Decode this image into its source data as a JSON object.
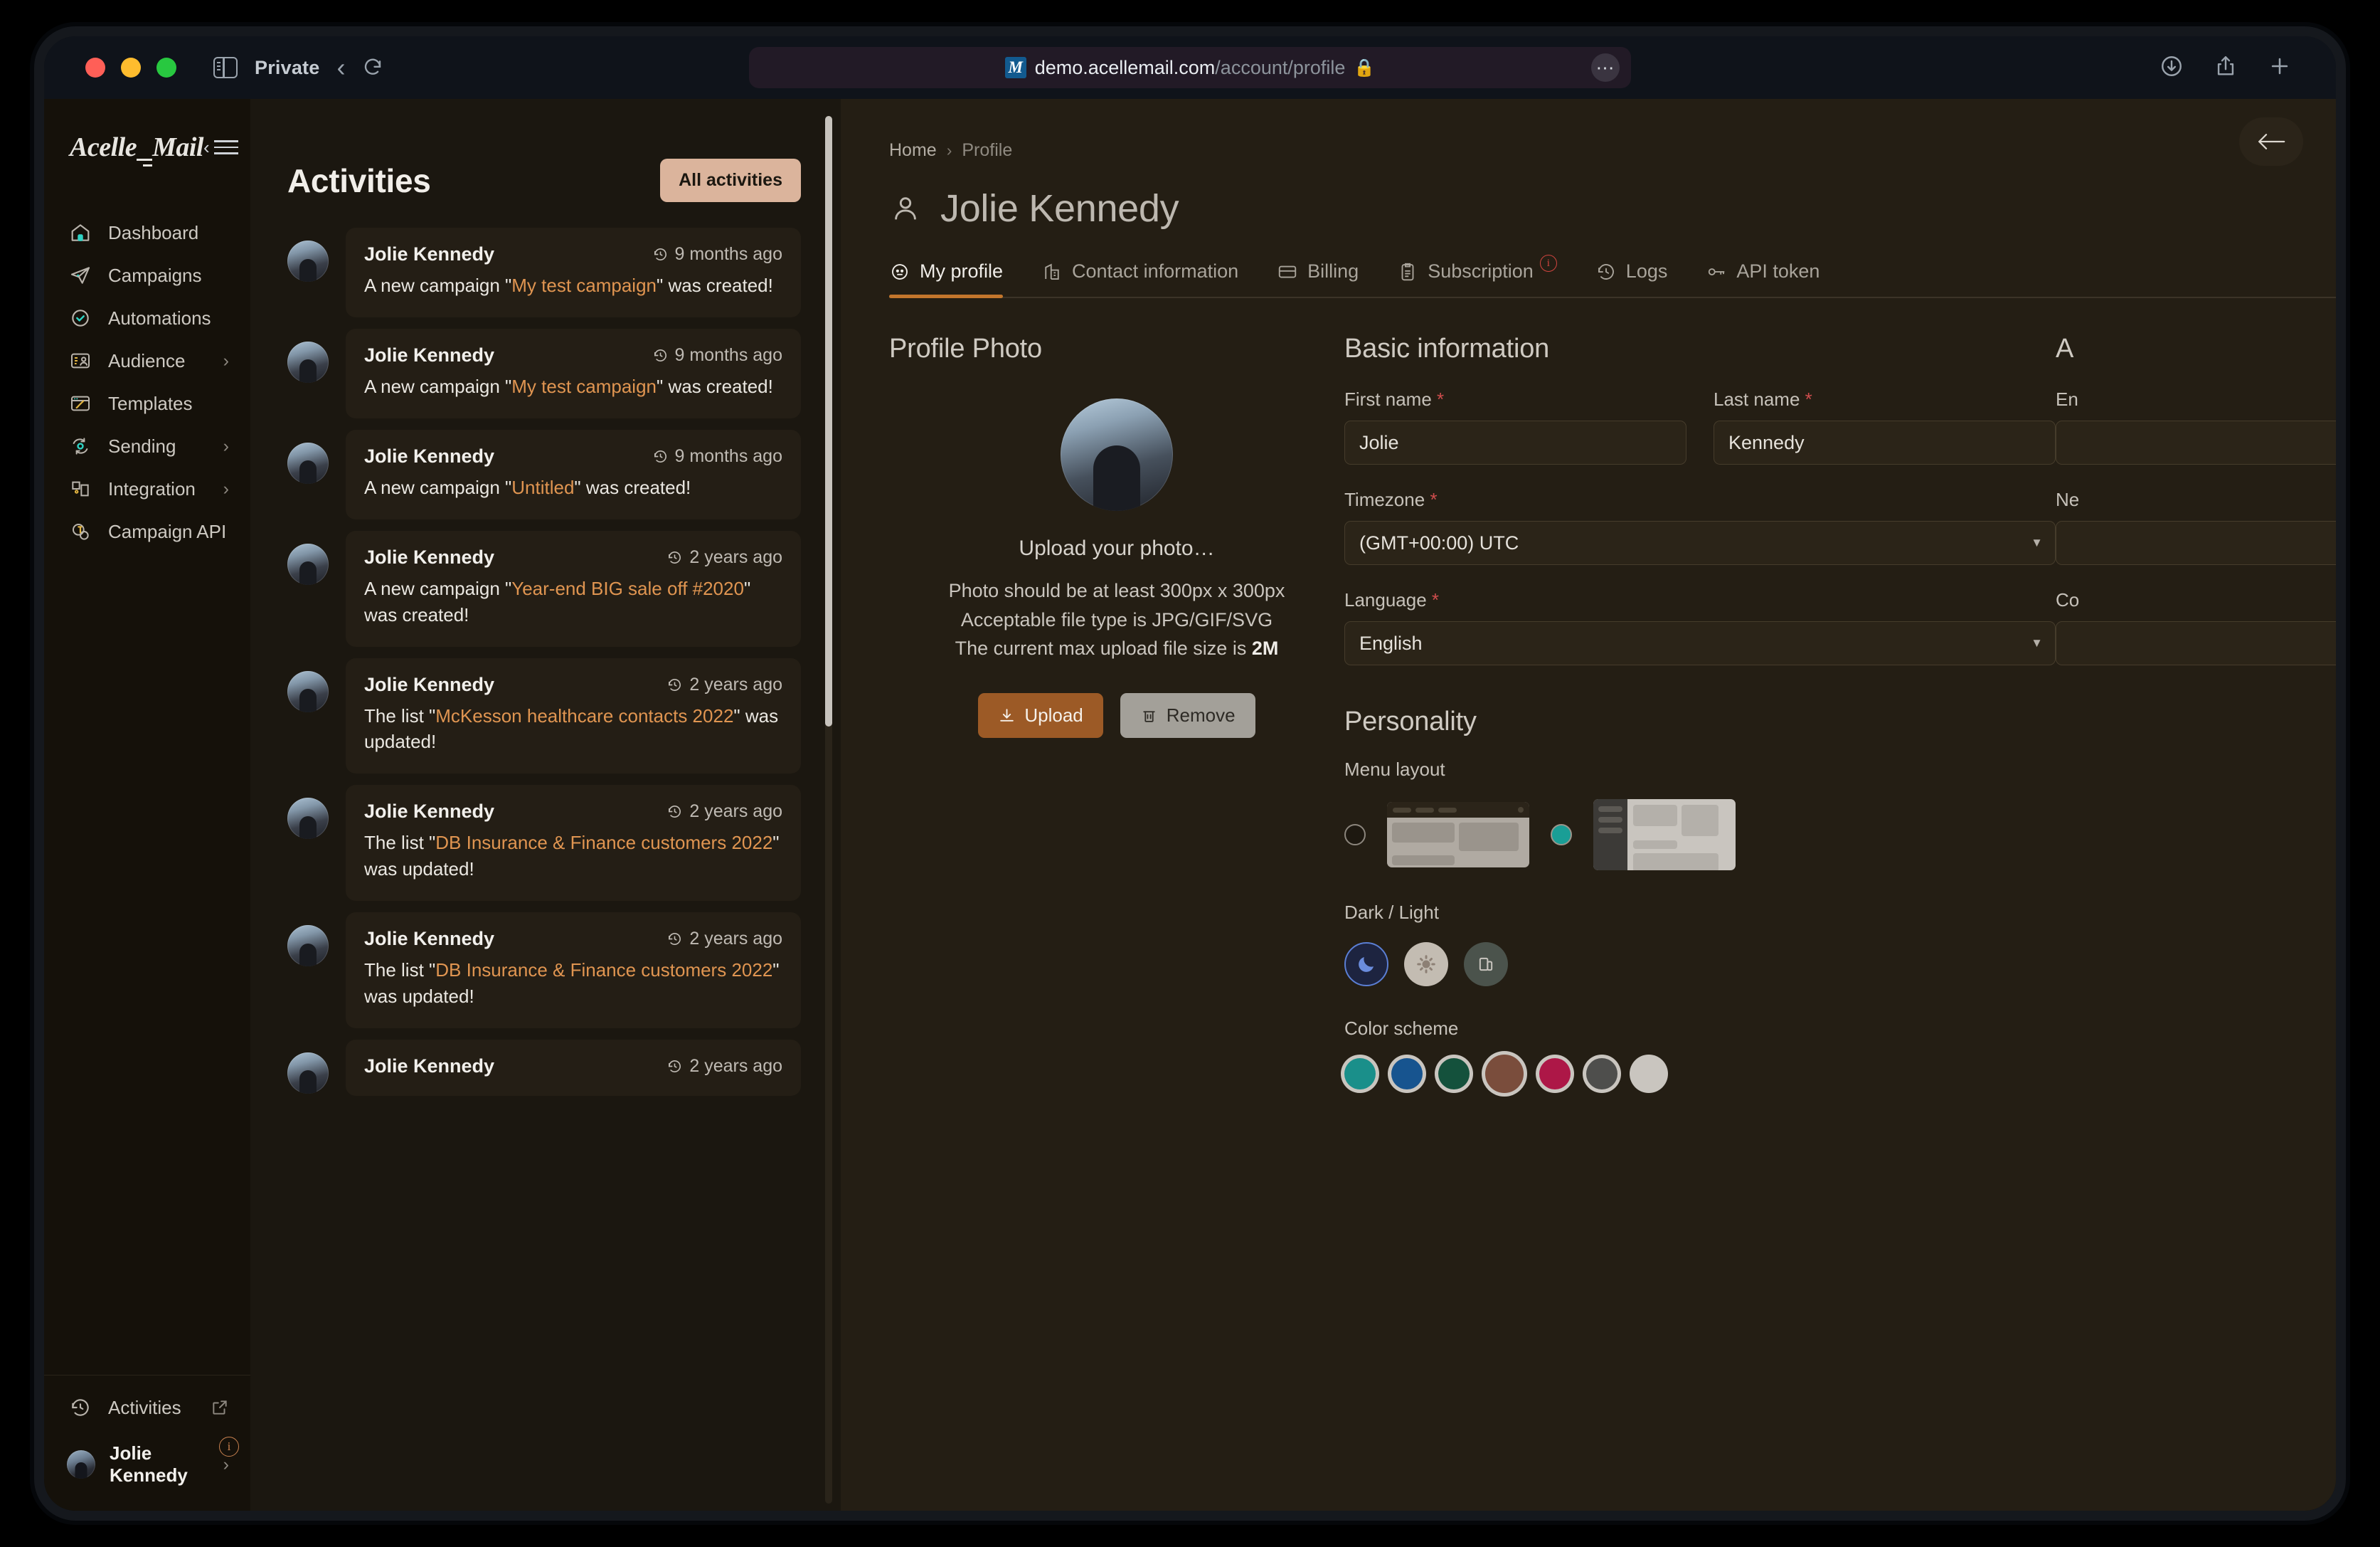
{
  "browser": {
    "private_label": "Private",
    "url_domain": "demo.acellemail.com",
    "url_path": "/account/profile",
    "favicon_letter": "M",
    "icons": [
      "sidebar-icon",
      "back-icon",
      "reload-icon",
      "lock-icon",
      "more-icon",
      "downloads-icon",
      "share-icon",
      "new-tab-icon"
    ]
  },
  "sidebar": {
    "brand": "Acelle",
    "brand2": "Mail",
    "items": [
      {
        "label": "Dashboard",
        "icon": "home-icon",
        "caret": ""
      },
      {
        "label": "Campaigns",
        "icon": "paper-plane-icon",
        "caret": ""
      },
      {
        "label": "Automations",
        "icon": "clock-check-icon",
        "caret": ""
      },
      {
        "label": "Audience",
        "icon": "audience-icon",
        "caret": "›"
      },
      {
        "label": "Templates",
        "icon": "template-brush-icon",
        "caret": ""
      },
      {
        "label": "Sending",
        "icon": "sync-gear-icon",
        "caret": "›"
      },
      {
        "label": "Integration",
        "icon": "integration-icon",
        "caret": "›"
      },
      {
        "label": "Campaign API",
        "icon": "api-gear-icon",
        "caret": ""
      }
    ],
    "footer": {
      "activities_label": "Activities",
      "activities_icon": "history-icon",
      "external_icon": "external-link-icon",
      "user_name": "Jolie Kennedy",
      "user_caret": "›",
      "info_badge": "i"
    }
  },
  "activities": {
    "title": "Activities",
    "all_button": "All activities",
    "back_icon": "arrow-left-icon",
    "items": [
      {
        "who": "Jolie Kennedy",
        "when": "9 months ago",
        "prefix": "A new campaign \"",
        "highlight": "My test campaign",
        "suffix": "\" was created!"
      },
      {
        "who": "Jolie Kennedy",
        "when": "9 months ago",
        "prefix": "A new campaign \"",
        "highlight": "My test campaign",
        "suffix": "\" was created!"
      },
      {
        "who": "Jolie Kennedy",
        "when": "9 months ago",
        "prefix": "A new campaign \"",
        "highlight": "Untitled",
        "suffix": "\" was created!"
      },
      {
        "who": "Jolie Kennedy",
        "when": "2 years ago",
        "prefix": "A new campaign \"",
        "highlight": "Year-end BIG sale off #2020",
        "suffix": "\" was created!"
      },
      {
        "who": "Jolie Kennedy",
        "when": "2 years ago",
        "prefix": "The list \"",
        "highlight": "McKesson healthcare contacts 2022",
        "suffix": "\" was updated!"
      },
      {
        "who": "Jolie Kennedy",
        "when": "2 years ago",
        "prefix": "The list \"",
        "highlight": "DB Insurance & Finance customers 2022",
        "suffix": "\" was updated!"
      },
      {
        "who": "Jolie Kennedy",
        "when": "2 years ago",
        "prefix": "The list \"",
        "highlight": "DB Insurance & Finance customers 2022",
        "suffix": "\" was updated!"
      },
      {
        "who": "Jolie Kennedy",
        "when": "2 years ago",
        "prefix": "",
        "highlight": "",
        "suffix": ""
      }
    ]
  },
  "main": {
    "breadcrumb": {
      "home": "Home",
      "sep": "›",
      "current": "Profile"
    },
    "title": "Jolie Kennedy",
    "title_icon": "person-icon",
    "tabs": [
      {
        "label": "My profile",
        "icon": "face-icon",
        "active": true,
        "badge": ""
      },
      {
        "label": "Contact information",
        "icon": "address-icon",
        "active": false,
        "badge": ""
      },
      {
        "label": "Billing",
        "icon": "card-icon",
        "active": false,
        "badge": ""
      },
      {
        "label": "Subscription",
        "icon": "clipboard-icon",
        "active": false,
        "badge": "i"
      },
      {
        "label": "Logs",
        "icon": "history-icon",
        "active": false,
        "badge": ""
      },
      {
        "label": "API token",
        "icon": "key-icon",
        "active": false,
        "badge": ""
      }
    ],
    "photo": {
      "section_title": "Profile Photo",
      "upload_hint": "Upload your photo…",
      "meta_line1": "Photo should be at least 300px x 300px",
      "meta_line2": "Acceptable file type is JPG/GIF/SVG",
      "meta_line3_pre": "The current max upload file size is ",
      "meta_line3_strong": "2M",
      "upload_button": "Upload",
      "upload_icon": "download-icon",
      "remove_button": "Remove",
      "remove_icon": "trash-icon"
    },
    "basic": {
      "section_title": "Basic information",
      "first_name_label": "First name",
      "first_name_value": "Jolie",
      "last_name_label": "Last name",
      "last_name_value": "Kennedy",
      "timezone_label": "Timezone",
      "timezone_value": "(GMT+00:00) UTC",
      "language_label": "Language",
      "language_value": "English",
      "required_mark": "*"
    },
    "personality": {
      "section_title": "Personality",
      "menu_layout_label": "Menu layout",
      "menu_layout_selected": 1,
      "dark_light_label": "Dark / Light",
      "theme_selected": "dark",
      "themes": [
        "moon-icon",
        "sun-icon",
        "auto-contrast-icon"
      ],
      "color_scheme_label": "Color scheme",
      "colors": [
        "#1a8f8a",
        "#17548f",
        "#14513c",
        "#7a4d3c",
        "#ad1747",
        "#4e4e4c",
        "#c9c5bf"
      ],
      "color_selected": 3
    },
    "account": {
      "section_title": "A",
      "label1": "En",
      "label2": "Ne",
      "label3": "Co"
    }
  }
}
